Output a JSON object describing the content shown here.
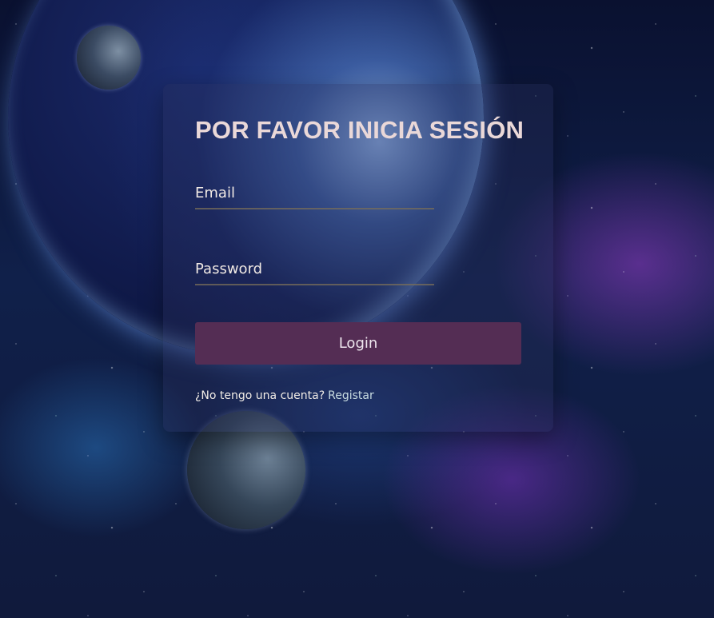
{
  "login_card": {
    "title": "POR FAVOR INICIA SESIÓN",
    "email_placeholder": "Email",
    "password_placeholder": "Password",
    "login_button": "Login",
    "no_account_text": "¿No tengo una cuenta?",
    "register_link": "Registar"
  },
  "colors": {
    "title": "#ead8d8",
    "button_background": "#542d54",
    "link": "#c8dbe0"
  }
}
